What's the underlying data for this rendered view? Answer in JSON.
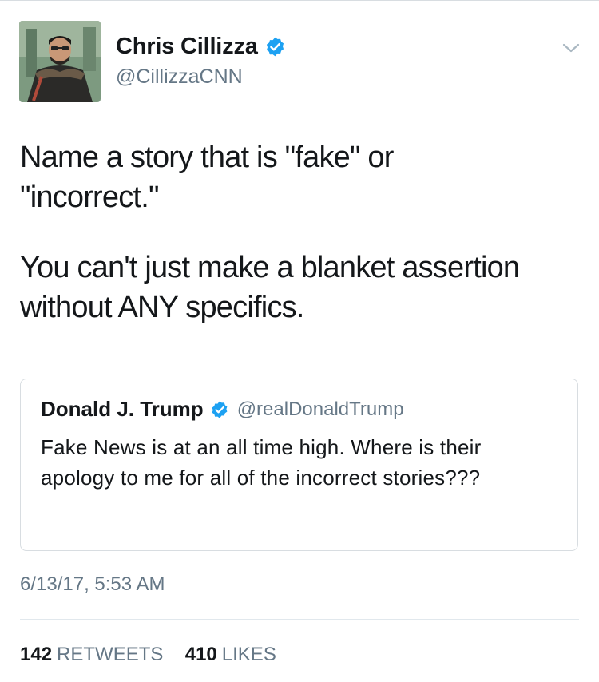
{
  "tweet": {
    "author": {
      "name": "Chris Cillizza",
      "handle": "@CillizzaCNN",
      "verified": true
    },
    "text": {
      "paragraph_1": "Name a story that is \"fake\" or\n\"incorrect.\"",
      "paragraph_2": "You can't just make a blanket assertion\nwithout ANY specifics."
    },
    "quoted_tweet": {
      "name": "Donald J. Trump",
      "handle": "@realDonaldTrump",
      "verified": true,
      "text": "Fake News is at an all time high. Where is their apology to me for all of the incorrect stories???"
    },
    "timestamp": "6/13/17, 5:53 AM",
    "stats": {
      "retweets_count": "142",
      "retweets_label": "RETWEETS",
      "likes_count": "410",
      "likes_label": "LIKES"
    }
  },
  "icons": {
    "verified": "verified-badge-icon",
    "menu": "chevron-down-icon"
  },
  "colors": {
    "verified_blue": "#1da1f2",
    "secondary_text": "#657786",
    "primary_text": "#14171a",
    "border": "#d8dde1"
  }
}
